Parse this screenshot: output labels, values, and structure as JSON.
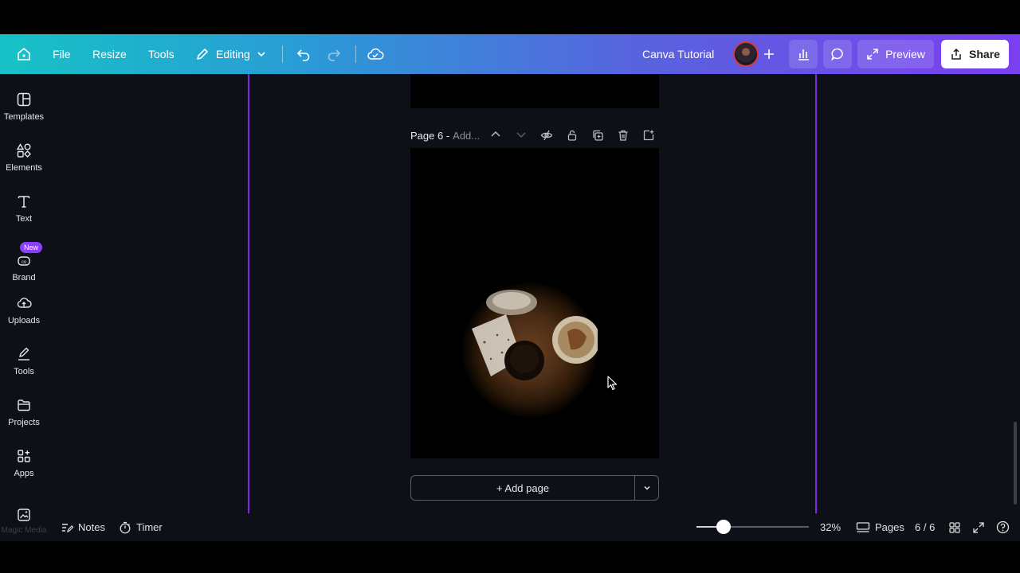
{
  "topbar": {
    "file_label": "File",
    "resize_label": "Resize",
    "tools_label": "Tools",
    "editing_label": "Editing",
    "doc_title": "Canva Tutorial",
    "preview_label": "Preview",
    "share_label": "Share",
    "home_icon": "home-icon",
    "undo_icon": "undo-icon",
    "redo_icon": "redo-icon",
    "cloud_icon": "cloud-check-icon",
    "analytics_icon": "bar-chart-icon",
    "comment_icon": "comment-icon"
  },
  "sidebar": {
    "items": [
      {
        "label": "Templates",
        "icon": "templates-icon"
      },
      {
        "label": "Elements",
        "icon": "elements-icon"
      },
      {
        "label": "Text",
        "icon": "text-icon"
      },
      {
        "label": "Brand",
        "icon": "brand-icon",
        "badge": "New"
      },
      {
        "label": "Uploads",
        "icon": "cloud-upload-icon"
      },
      {
        "label": "Tools",
        "icon": "pen-tool-icon"
      },
      {
        "label": "Projects",
        "icon": "folder-icon"
      },
      {
        "label": "Apps",
        "icon": "apps-icon"
      },
      {
        "label": "Magic Media",
        "icon": "magic-media-icon"
      }
    ]
  },
  "page": {
    "title": "Page 6 -",
    "subtitle_placeholder": "Add...",
    "add_page_label": "+ Add page"
  },
  "bottombar": {
    "notes_label": "Notes",
    "timer_label": "Timer",
    "zoom_percent": 32,
    "zoom_label": "32%",
    "pages_label": "Pages",
    "page_count": "6 / 6"
  },
  "colors": {
    "accent_purple": "#7d2ae8",
    "badge_purple": "#8b3dff",
    "canvas_bg": "#0d1117"
  }
}
